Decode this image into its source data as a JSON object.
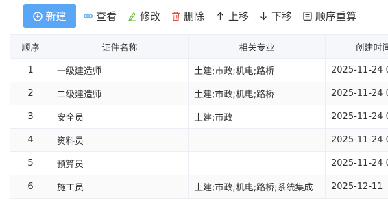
{
  "toolbar": {
    "new_label": "新建",
    "view_label": "查看",
    "edit_label": "修改",
    "delete_label": "删除",
    "up_label": "上移",
    "down_label": "下移",
    "reset_label": "顺序重算",
    "accent_color": "#5aa6f6",
    "delete_icon_color": "#e5483f"
  },
  "table": {
    "headers": [
      "顺序",
      "证件名称",
      "相关专业",
      "创建时间"
    ],
    "rows": [
      {
        "no": "1",
        "name": "一级建造师",
        "major": "土建;市政;机电;路桥",
        "time": "2025-11-24 0"
      },
      {
        "no": "2",
        "name": "二级建造师",
        "major": "土建;市政;机电;路桥",
        "time": "2025-11-24 0"
      },
      {
        "no": "3",
        "name": "安全员",
        "major": "土建;市政",
        "time": "2025-11-24 0"
      },
      {
        "no": "4",
        "name": "资料员",
        "major": "",
        "time": "2025-11-24 0"
      },
      {
        "no": "5",
        "name": "预算员",
        "major": "",
        "time": "2025-11-24 0"
      },
      {
        "no": "6",
        "name": "施工员",
        "major": "土建;市政;机电;路桥;系统集成",
        "time": "2025-12-11"
      }
    ]
  }
}
